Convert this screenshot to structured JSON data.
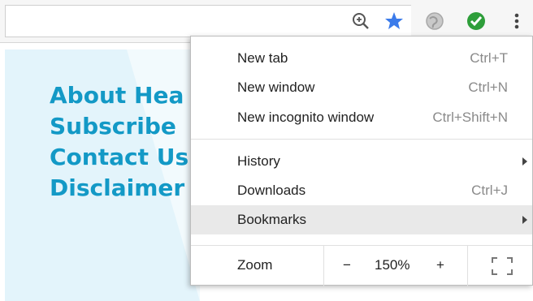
{
  "toolbar": {
    "icons": [
      "zoom-icon",
      "bookmark-star-icon",
      "extension-globe-icon",
      "extension-check-icon",
      "menu-kebab-icon"
    ],
    "star_color": "#3b7bea",
    "check_color": "#2e9e3a"
  },
  "page": {
    "links": [
      "About Hea",
      "Subscribe",
      "Contact Us",
      "Disclaimer"
    ],
    "link_color": "#1399c6",
    "panel_color": "#e3f4fb"
  },
  "menu": {
    "items": [
      {
        "label": "New tab",
        "shortcut": "Ctrl+T"
      },
      {
        "label": "New window",
        "shortcut": "Ctrl+N"
      },
      {
        "label": "New incognito window",
        "shortcut": "Ctrl+Shift+N"
      },
      {
        "label": "History",
        "shortcut": ""
      },
      {
        "label": "Downloads",
        "shortcut": "Ctrl+J"
      },
      {
        "label": "Bookmarks",
        "shortcut": ""
      }
    ],
    "zoom": {
      "label": "Zoom",
      "minus": "−",
      "value": "150%",
      "plus": "+"
    }
  }
}
